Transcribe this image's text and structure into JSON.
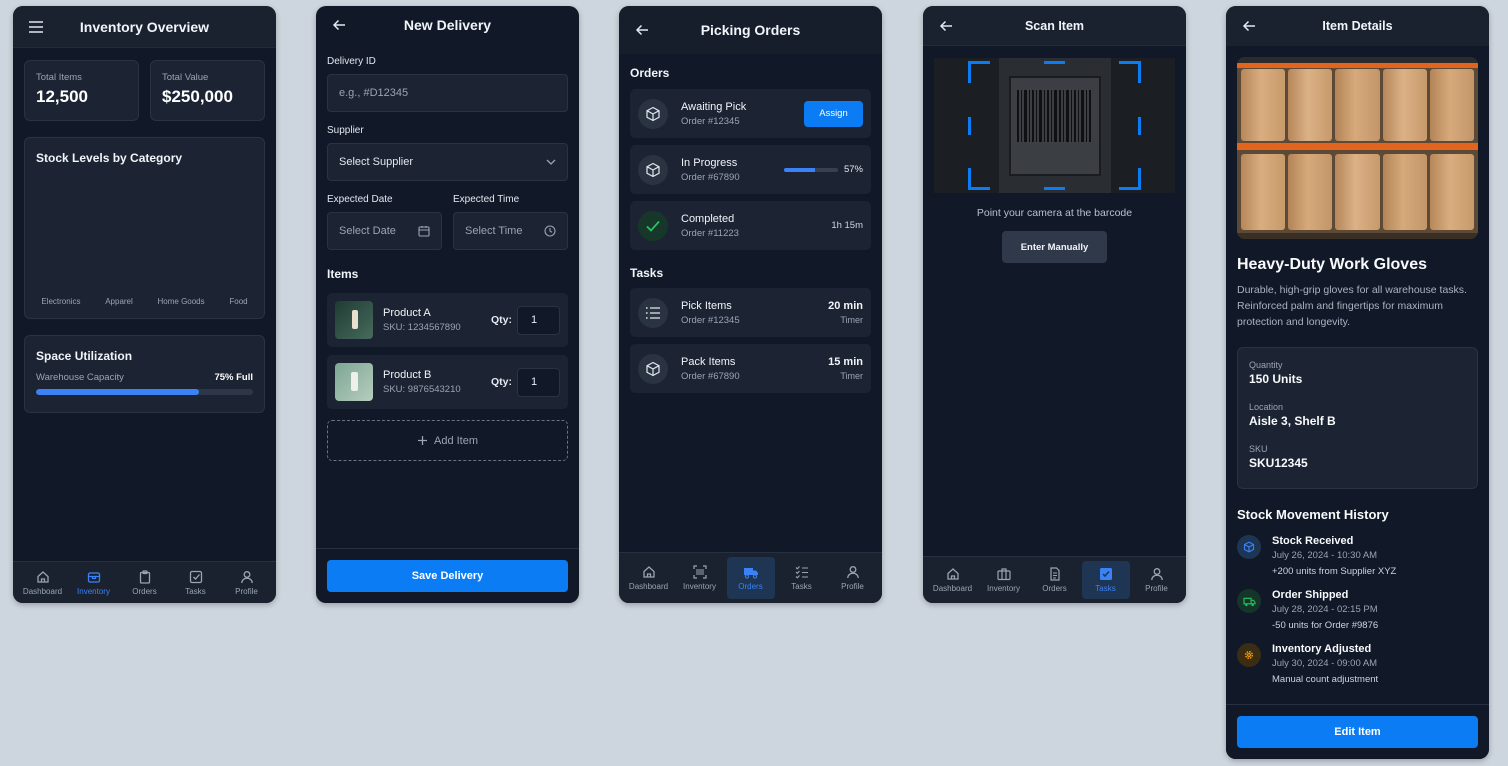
{
  "colors": {
    "accent": "#0b7cf4",
    "background": "#111827",
    "card": "#1c2433",
    "success": "#22c55e",
    "warning": "#f59e0b"
  },
  "screen1": {
    "title": "Inventory Overview",
    "stats": [
      {
        "label": "Total Items",
        "value": "12,500"
      },
      {
        "label": "Total Value",
        "value": "$250,000"
      }
    ],
    "stock": {
      "title": "Stock Levels by Category",
      "categories": [
        "Electronics",
        "Apparel",
        "Home Goods",
        "Food"
      ]
    },
    "space": {
      "title": "Space Utilization",
      "label": "Warehouse Capacity",
      "value_text": "75% Full",
      "percent": 75
    },
    "nav": [
      "Dashboard",
      "Inventory",
      "Orders",
      "Tasks",
      "Profile"
    ]
  },
  "screen2": {
    "title": "New Delivery",
    "delivery_id_label": "Delivery ID",
    "delivery_id_placeholder": "e.g., #D12345",
    "supplier_label": "Supplier",
    "supplier_value": "Select Supplier",
    "date_label": "Expected Date",
    "date_value": "Select Date",
    "time_label": "Expected Time",
    "time_value": "Select Time",
    "items_title": "Items",
    "items": [
      {
        "name": "Product A",
        "sku": "SKU: 1234567890",
        "qty_label": "Qty:",
        "qty": "1"
      },
      {
        "name": "Product B",
        "sku": "SKU: 9876543210",
        "qty_label": "Qty:",
        "qty": "1"
      }
    ],
    "add_item": "Add Item",
    "save": "Save Delivery"
  },
  "screen3": {
    "title": "Picking Orders",
    "orders_title": "Orders",
    "orders": [
      {
        "status": "Awaiting Pick",
        "order": "Order #12345",
        "action": "Assign"
      },
      {
        "status": "In Progress",
        "order": "Order #67890",
        "progress_text": "57%",
        "progress": 57
      },
      {
        "status": "Completed",
        "order": "Order #11223",
        "time": "1h 15m"
      }
    ],
    "tasks_title": "Tasks",
    "tasks": [
      {
        "name": "Pick Items",
        "order": "Order #12345",
        "duration": "20 min",
        "sub": "Timer"
      },
      {
        "name": "Pack Items",
        "order": "Order #67890",
        "duration": "15 min",
        "sub": "Timer"
      }
    ],
    "nav": [
      "Dashboard",
      "Inventory",
      "Orders",
      "Tasks",
      "Profile"
    ]
  },
  "screen4": {
    "title": "Scan Item",
    "hint": "Point your camera at the barcode",
    "manual": "Enter Manually",
    "nav": [
      "Dashboard",
      "Inventory",
      "Orders",
      "Tasks",
      "Profile"
    ]
  },
  "screen5": {
    "title": "Item Details",
    "name": "Heavy-Duty Work Gloves",
    "description": "Durable, high-grip gloves for all warehouse tasks. Reinforced palm and fingertips for maximum protection and longevity.",
    "quantity_label": "Quantity",
    "quantity": "150 Units",
    "location_label": "Location",
    "location": "Aisle 3, Shelf B",
    "sku_label": "SKU",
    "sku": "SKU12345",
    "history_title": "Stock Movement History",
    "history": [
      {
        "title": "Stock Received",
        "date": "July 26, 2024 - 10:30 AM",
        "detail": "+200 units from Supplier XYZ"
      },
      {
        "title": "Order Shipped",
        "date": "July 28, 2024 - 02:15 PM",
        "detail": "-50 units for Order #9876"
      },
      {
        "title": "Inventory Adjusted",
        "date": "July 30, 2024 - 09:00 AM",
        "detail": "Manual count adjustment"
      }
    ],
    "edit": "Edit Item"
  }
}
